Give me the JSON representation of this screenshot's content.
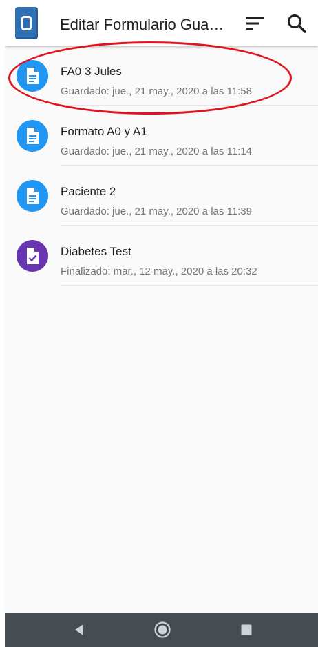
{
  "appbar": {
    "title": "Editar Formulario Guardado",
    "logo_icon": "app-logo-icon",
    "sort_icon": "sort-icon",
    "search_icon": "search-icon"
  },
  "forms": [
    {
      "title": "FA0 3 Jules",
      "status": "Guardado: jue., 21 may., 2020 a las 11:58",
      "icon": "saved-form-icon",
      "icon_color": "#2196f3",
      "highlighted": true
    },
    {
      "title": "Formato A0 y A1",
      "status": "Guardado: jue., 21 may., 2020 a las 11:14",
      "icon": "saved-form-icon",
      "icon_color": "#2196f3"
    },
    {
      "title": "Paciente 2",
      "status": "Guardado: jue., 21 may., 2020 a las 11:39",
      "icon": "saved-form-icon",
      "icon_color": "#2196f3"
    },
    {
      "title": "Diabetes Test",
      "status": "Finalizado: mar., 12 may., 2020 a las 20:32",
      "icon": "finalized-form-icon",
      "icon_color": "#6a35b0"
    }
  ],
  "navbar": {
    "back_icon": "back-triangle-icon",
    "home_icon": "home-circle-icon",
    "recents_icon": "recents-square-icon",
    "background": "#454c52"
  },
  "annotation_color": "#e0141e"
}
